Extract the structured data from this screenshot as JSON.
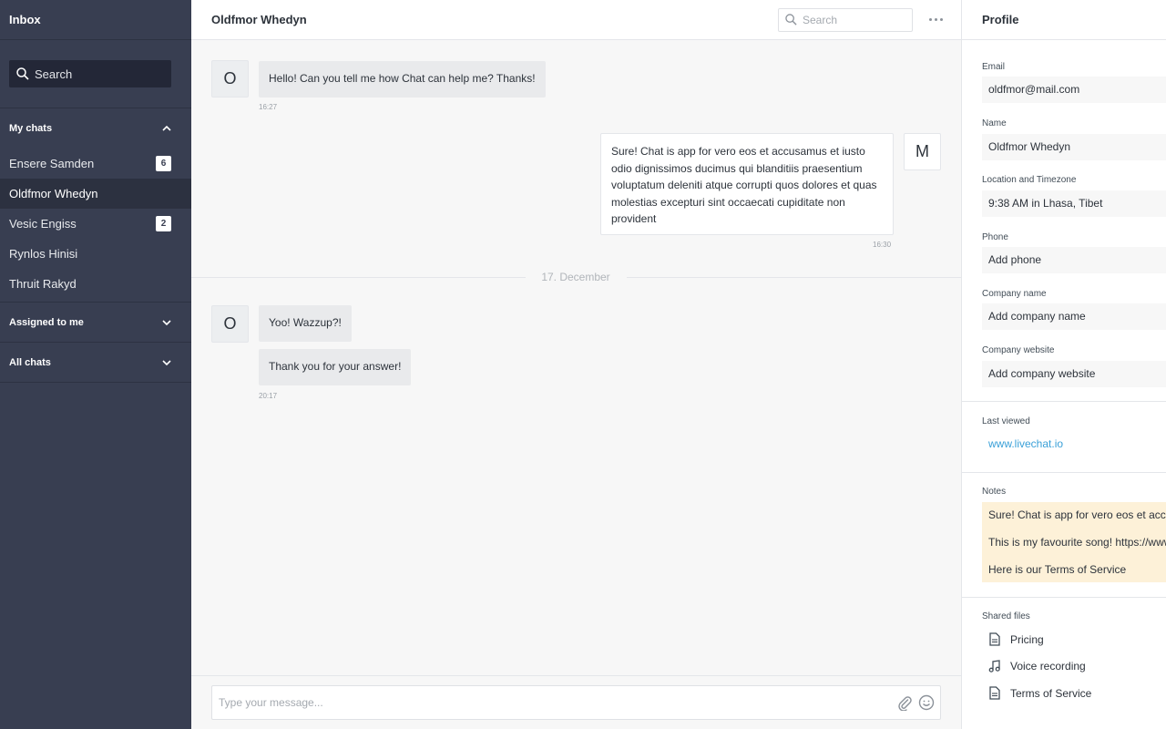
{
  "sidebar": {
    "title": "Inbox",
    "search_label": "Search",
    "sections": {
      "my_chats": "My chats",
      "assigned": "Assigned to me",
      "all": "All chats"
    },
    "chats": [
      {
        "name": "Ensere Samden",
        "badge": "6"
      },
      {
        "name": "Oldfmor Whedyn",
        "badge": ""
      },
      {
        "name": "Vesic Engiss",
        "badge": "2"
      },
      {
        "name": "Rynlos Hinisi",
        "badge": ""
      },
      {
        "name": "Thruit Rakyd",
        "badge": ""
      }
    ]
  },
  "chat": {
    "title": "Oldfmor Whedyn",
    "search_placeholder": "Search",
    "messages": [
      {
        "avatar": "O",
        "text": "Hello! Can you tell me how Chat can help me? Thanks!",
        "time": "16:27"
      },
      {
        "avatar": "M",
        "text": "Sure! Chat is app for vero eos et accusamus et iusto odio dignissimos ducimus qui blanditiis praesentium voluptatum deleniti atque corrupti quos dolores et quas molestias excepturi sint occaecati cupiditate non provident",
        "time": "16:30"
      },
      {
        "avatar": "O",
        "text": "Yoo! Wazzup?!",
        "time": ""
      },
      {
        "avatar": "",
        "text": "Thank you for your answer!",
        "time": "20:17"
      }
    ],
    "date_separator": "17. December",
    "input_placeholder": "Type your message..."
  },
  "profile": {
    "title": "Profile",
    "email_label": "Email",
    "email": "oldfmor@mail.com",
    "name_label": "Name",
    "name": "Oldfmor Whedyn",
    "location_label": "Location and Timezone",
    "location": "9:38 AM in Lhasa, Tibet",
    "phone_label": "Phone",
    "phone": "Add phone",
    "company_label": "Company name",
    "company": "Add company name",
    "website_label": "Company website",
    "website": "Add company website",
    "last_viewed_label": "Last viewed",
    "last_viewed": "www.livechat.io",
    "notes_label": "Notes",
    "notes": [
      "Sure! Chat is app for vero eos et accusamus",
      "This is my favourite song! https://www.youtube.com",
      "Here is our Terms of Service"
    ],
    "files_label": "Shared files",
    "files": [
      {
        "name": "Pricing",
        "icon": "document-icon"
      },
      {
        "name": "Voice recording",
        "icon": "music-note-icon"
      },
      {
        "name": "Terms of Service",
        "icon": "document-icon"
      }
    ]
  },
  "colors": {
    "sidebar_bg": "#383e51",
    "sidebar_active": "#2c3140",
    "link": "#3aa0d8",
    "note_bg": "#fdf1d8"
  }
}
